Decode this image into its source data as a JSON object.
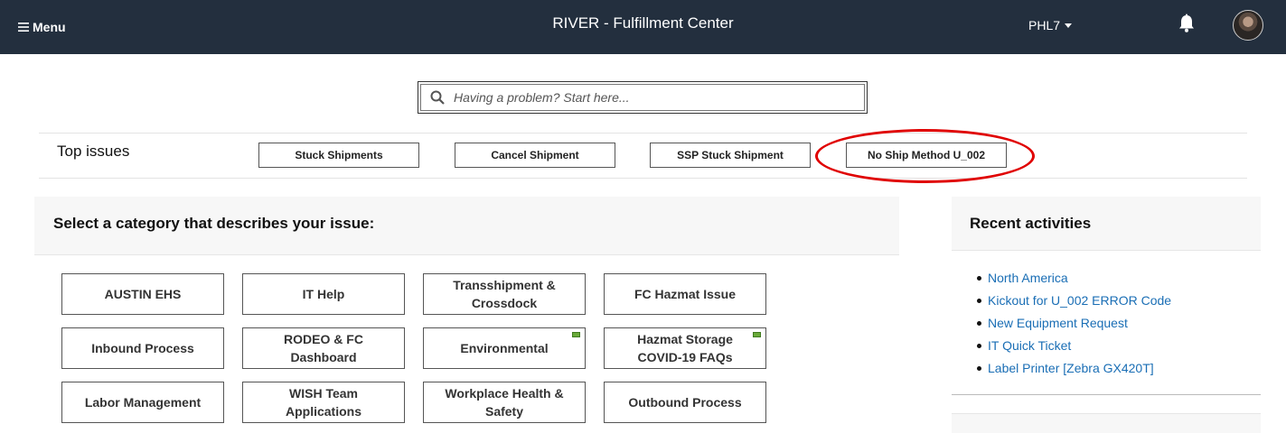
{
  "header": {
    "menu_label": "Menu",
    "title": "RIVER - Fulfillment Center",
    "site": "PHL7",
    "bg_color": "#232f3e"
  },
  "search": {
    "placeholder": "Having a problem? Start here..."
  },
  "top_issues": {
    "label": "Top issues",
    "buttons": [
      "Stuck Shipments",
      "Cancel Shipment",
      "SSP Stuck Shipment",
      "No Ship Method U_002"
    ],
    "highlight_color": "#e00000"
  },
  "categories": {
    "title": "Select a category that describes your issue:",
    "items": [
      {
        "label": "AUSTIN EHS"
      },
      {
        "label": "IT Help"
      },
      {
        "label": "Transshipment & Crossdock"
      },
      {
        "label": "FC Hazmat Issue"
      },
      {
        "label": "Inbound Process"
      },
      {
        "label": "RODEO & FC Dashboard"
      },
      {
        "label": "Environmental"
      },
      {
        "label": "Hazmat Storage COVID-19 FAQs"
      },
      {
        "label": "Labor Management"
      },
      {
        "label": "WISH Team Applications"
      },
      {
        "label": "Workplace Health & Safety"
      },
      {
        "label": "Outbound Process"
      }
    ]
  },
  "recent": {
    "title": "Recent activities",
    "items": [
      "North America",
      "Kickout for U_002 ERROR Code",
      "New Equipment Request",
      "IT Quick Ticket",
      "Label Printer [Zebra GX420T]"
    ],
    "link_color": "#1a6eb5"
  }
}
